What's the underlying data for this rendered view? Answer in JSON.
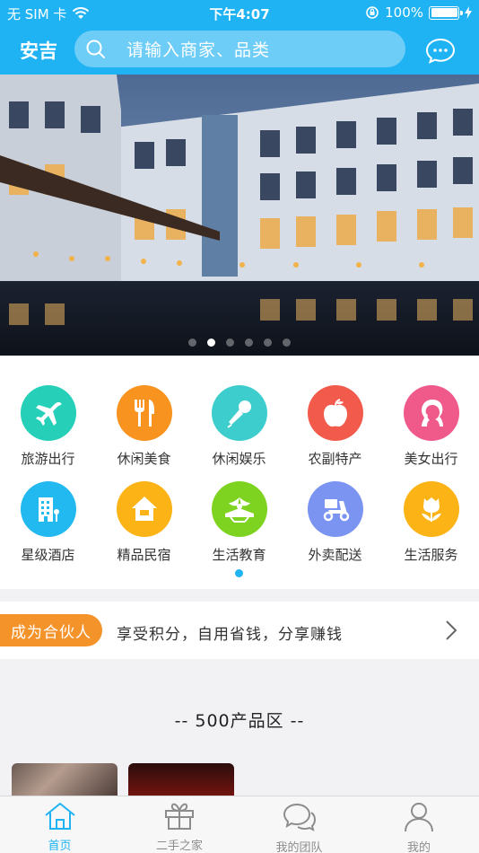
{
  "status_bar": {
    "carrier": "无 SIM 卡",
    "time": "下午4:07",
    "battery": "100%"
  },
  "header": {
    "city": "安吉",
    "search_placeholder": "请输入商家、品类"
  },
  "banner": {
    "slide_count": 6,
    "active_slide": 2
  },
  "categories": [
    {
      "label": "旅游出行",
      "icon": "airplane-icon",
      "color": "#25cfb8"
    },
    {
      "label": "休闲美食",
      "icon": "fork-knife-icon",
      "color": "#f7931e"
    },
    {
      "label": "休闲娱乐",
      "icon": "microphone-icon",
      "color": "#3ccdcc"
    },
    {
      "label": "农副特产",
      "icon": "apple-icon",
      "color": "#f25b4b"
    },
    {
      "label": "美女出行",
      "icon": "woman-profile-icon",
      "color": "#ef5a8b"
    },
    {
      "label": "星级酒店",
      "icon": "hotel-icon",
      "color": "#22b8f0"
    },
    {
      "label": "精品民宿",
      "icon": "house-icon",
      "color": "#fbb315"
    },
    {
      "label": "生活教育",
      "icon": "education-icon",
      "color": "#7ed321"
    },
    {
      "label": "外卖配送",
      "icon": "scooter-icon",
      "color": "#7b94f2"
    },
    {
      "label": "生活服务",
      "icon": "tulip-icon",
      "color": "#fbb315"
    }
  ],
  "partner": {
    "tag": "成为合伙人",
    "text": "享受积分，自用省钱，分享赚钱"
  },
  "products": {
    "title": "--   500产品区   --"
  },
  "tabs": [
    {
      "label": "首页",
      "icon": "home-icon",
      "active": true
    },
    {
      "label": "二手之家",
      "icon": "gift-icon",
      "active": false
    },
    {
      "label": "我的团队",
      "icon": "chat-bubbles-icon",
      "active": false
    },
    {
      "label": "我的",
      "icon": "user-icon",
      "active": false
    }
  ],
  "colors": {
    "brand": "#1fb3f3",
    "partner_tag": "#f5932b"
  }
}
